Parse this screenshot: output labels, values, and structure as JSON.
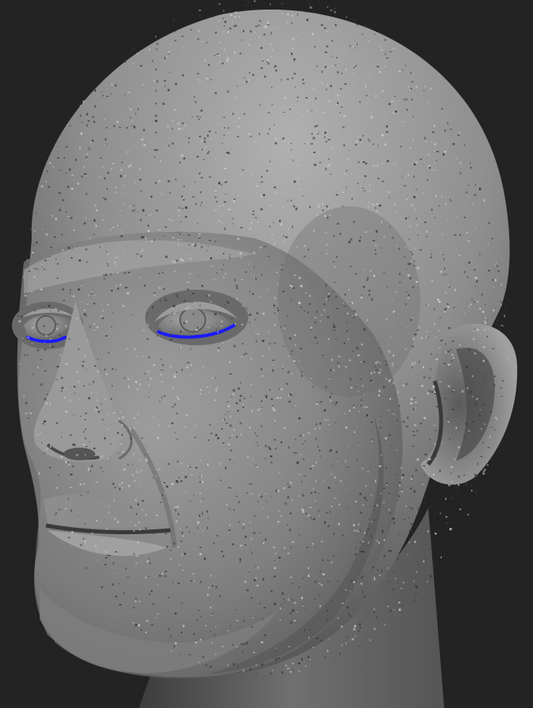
{
  "viewport": {
    "background_color": "#232323",
    "subject": "head-sculpt",
    "mesh_color": "#8e8e8e",
    "highlight_color": "#b4b4b4",
    "shadow_color": "#4a4a4a",
    "stubble_color": "#3a3a3a",
    "stubble_light_color": "#c8c8c8",
    "selection_color": "#1a1aff",
    "selected_edges": [
      "left-lower-eyelid-edge",
      "right-lower-eyelid-edge"
    ]
  }
}
